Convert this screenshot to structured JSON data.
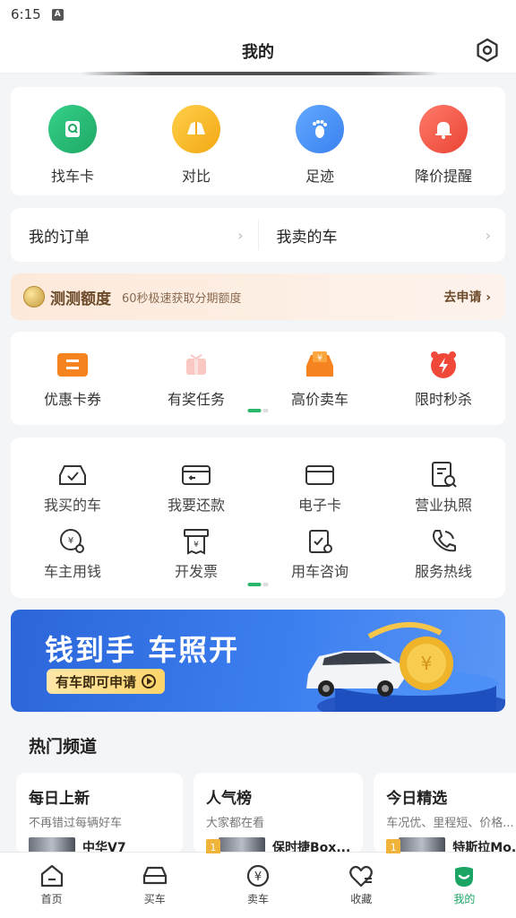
{
  "status": {
    "time": "6:15",
    "indicator": "A"
  },
  "header": {
    "title": "我的"
  },
  "quick_actions": [
    {
      "label": "找车卡",
      "icon": "car-card-icon",
      "color": "#2bbf78"
    },
    {
      "label": "对比",
      "icon": "compare-icon",
      "color": "#f6b41a"
    },
    {
      "label": "足迹",
      "icon": "footprint-icon",
      "color": "#3e8ef7"
    },
    {
      "label": "降价提醒",
      "icon": "bell-icon",
      "color": "#f25b4b"
    }
  ],
  "orders": {
    "my_orders": "我的订单",
    "my_sold": "我卖的车"
  },
  "credit": {
    "name": "测测额度",
    "desc": "60秒极速获取分期额度",
    "apply": "去申请"
  },
  "promos": [
    {
      "label": "优惠卡券",
      "icon": "coupon-icon"
    },
    {
      "label": "有奖任务",
      "icon": "gift-task-icon"
    },
    {
      "label": "高价卖车",
      "icon": "sell-car-icon"
    },
    {
      "label": "限时秒杀",
      "icon": "flash-sale-icon"
    }
  ],
  "services": [
    {
      "label": "我买的车",
      "icon": "bought-car-icon"
    },
    {
      "label": "我要还款",
      "icon": "repay-icon"
    },
    {
      "label": "电子卡",
      "icon": "e-card-icon"
    },
    {
      "label": "营业执照",
      "icon": "license-icon"
    },
    {
      "label": "车主用钱",
      "icon": "owner-loan-icon"
    },
    {
      "label": "开发票",
      "icon": "invoice-icon"
    },
    {
      "label": "用车咨询",
      "icon": "consult-icon"
    },
    {
      "label": "服务热线",
      "icon": "hotline-icon"
    }
  ],
  "banner": {
    "headline": "钱到手 车照开",
    "cta": "有车即可申请"
  },
  "hot": {
    "title": "热门频道",
    "channels": [
      {
        "title": "每日上新",
        "subtitle": "不再错过每辆好车",
        "rank": "",
        "car": "中华V7"
      },
      {
        "title": "人气榜",
        "subtitle": "大家都在看",
        "rank": "1",
        "car": "保时捷Box..."
      },
      {
        "title": "今日精选",
        "subtitle": "车况优、里程短、价格...",
        "rank": "1",
        "car": "特斯拉Mo..."
      }
    ]
  },
  "tabs": [
    {
      "label": "首页",
      "icon": "home-icon"
    },
    {
      "label": "买车",
      "icon": "buy-car-icon"
    },
    {
      "label": "卖车",
      "icon": "sell-yuan-icon"
    },
    {
      "label": "收藏",
      "icon": "favorite-icon"
    },
    {
      "label": "我的",
      "icon": "profile-icon",
      "active": true
    }
  ],
  "colors": {
    "accent": "#1aa564",
    "banner": "#2b66d9"
  }
}
